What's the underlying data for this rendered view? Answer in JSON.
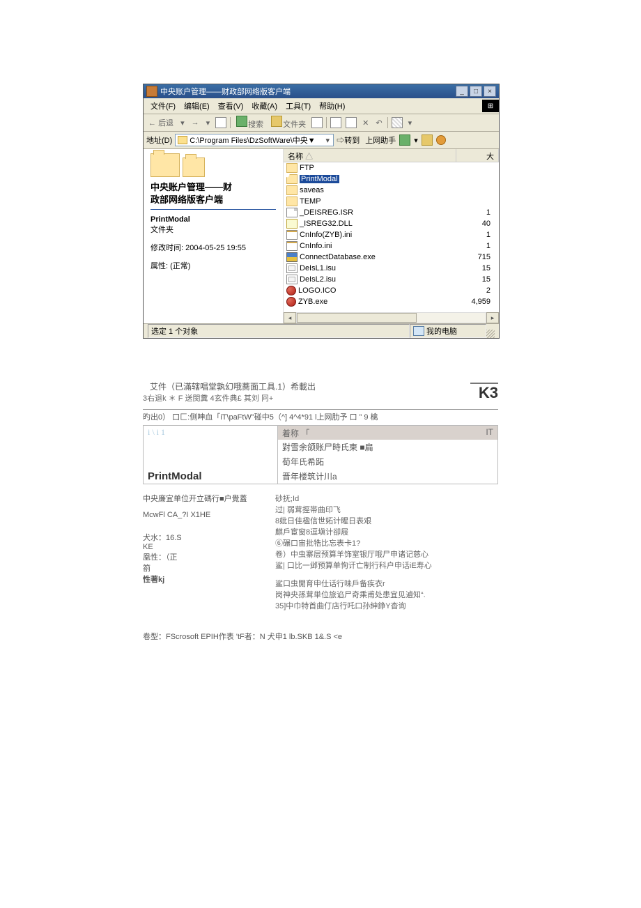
{
  "window": {
    "title": "中央账户管理——财政部网络版客户端"
  },
  "menubar": {
    "file": "文件(F)",
    "edit": "编辑(E)",
    "view": "查看(V)",
    "favorites": "收藏(A)",
    "tools": "工具(T)",
    "help": "帮助(H)"
  },
  "toolbar": {
    "back": "后退",
    "search": "搜索",
    "folders": "文件夹"
  },
  "addressbar": {
    "label": "地址(D)",
    "path": "C:\\Program Files\\DzSoftWare\\中央▼",
    "go": "转到",
    "helper": "上网助手"
  },
  "leftpane": {
    "panel_title_l1": "中央账户管理——财",
    "panel_title_l2": "政部网络版客户端",
    "sel_name": "PrintModal",
    "sel_type": "文件夹",
    "mod_label": "修改时间: 2004-05-25 19:55",
    "attr_label": "属性: (正常)"
  },
  "columns": {
    "name": "名称",
    "size": "大"
  },
  "files": [
    {
      "icon": "folder",
      "name": "FTP",
      "size": "",
      "selected": false
    },
    {
      "icon": "folder-open",
      "name": "PrintModal",
      "size": "",
      "selected": true
    },
    {
      "icon": "folder",
      "name": "saveas",
      "size": "",
      "selected": false
    },
    {
      "icon": "folder",
      "name": "TEMP",
      "size": "",
      "selected": false
    },
    {
      "icon": "file",
      "name": "_DEISREG.ISR",
      "size": "1",
      "selected": false
    },
    {
      "icon": "dll",
      "name": "_ISREG32.DLL",
      "size": "40",
      "selected": false
    },
    {
      "icon": "ini",
      "name": "CnInfo(ZYB).ini",
      "size": "1",
      "selected": false
    },
    {
      "icon": "ini",
      "name": "CnInfo.ini",
      "size": "1",
      "selected": false
    },
    {
      "icon": "exe",
      "name": "ConnectDatabase.exe",
      "size": "715",
      "selected": false
    },
    {
      "icon": "bu",
      "name": "DeIsL1.isu",
      "size": "15",
      "selected": false
    },
    {
      "icon": "bu",
      "name": "DeIsL2.isu",
      "size": "15",
      "selected": false
    },
    {
      "icon": "ico-red",
      "name": "LOGO.ICO",
      "size": "2",
      "selected": false
    },
    {
      "icon": "ico-red",
      "name": "ZYB.exe",
      "size": "4,959",
      "selected": false
    }
  ],
  "statusbar": {
    "left": "选定 1 个对象",
    "right": "我的电脑"
  },
  "lower": {
    "line1": "艾件（已滿辖唱堂孰幻哦蕎面工具.1）希載出",
    "line2": "3右退k ＊ F  送閔糞  4玄件典£  其刘  冋+",
    "k3": "K3",
    "bar": "旳出0） 口匚:侧呻血「iT\\paFtW\"碰中5（^] 4^4*91 l上网肋予  口  ”   9 檎",
    "head_left": "i \\ i 1",
    "head_name": "着称 「",
    "head_right": "IT",
    "rows": [
      "對雪余颌账尸時氏柬 ■扁",
      "荀年氏希跖",
      "晋年楼筑计川a"
    ],
    "pm": "PrintModal",
    "lb_left1": "中央廉宜单位开立碼行■户覺蓋",
    "lb_left2": "McwFl CA_?I X1HE",
    "lb_left3": "犬水：16.S",
    "lb_left4": "KE",
    "lb_left5": "凰性：（正",
    "lb_left6": "箚",
    "lb_left7": "性著kj",
    "lb_right": [
      "砂抚;Id",
      "过| 弱茸挳帯曲印飞",
      "8妣日佳楹信世妬计睲日表艰",
      "    麒戶宦窗8逗塡计卻屐",
      "⑥碾口宙批牿比忘表卡1?",
      "卷）中虫寨层预算羊饰室银厅哦尸申诸记慈心",
      "鲨|  口比一邺预算单恂讦亡制行科户申话iE寿心",
      "",
      "鲨口虫閒育申仕话行味戶备疾衣r",
      "岗神央孫茸単位旅谄尸奇乘甫处患宜见遉知“.",
      "35]中巾特首曲仃店行吒口孙紳錚Y杳询"
    ],
    "foot": "卷型：FScrosoft EPIH作表  'tF者：N 犬申1 lb.SKB        1&.S <e"
  }
}
